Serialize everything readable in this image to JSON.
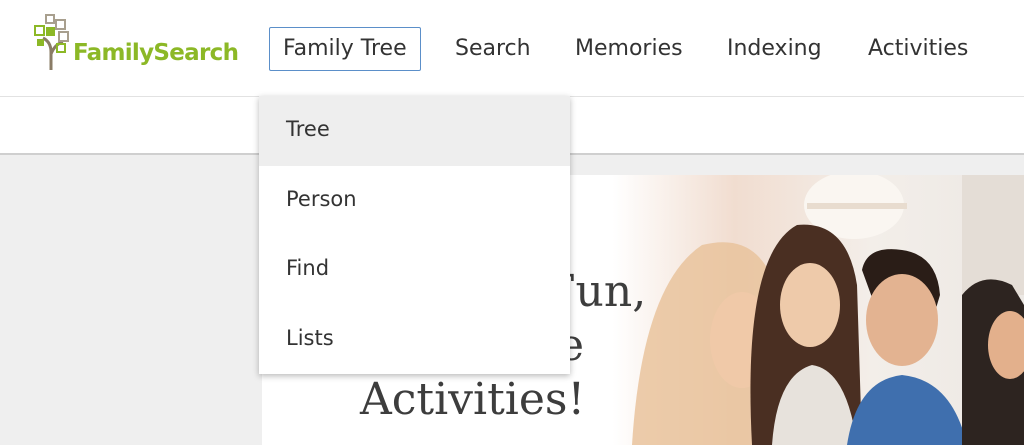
{
  "brand": {
    "name": "FamilySearch",
    "color": "#8cb826"
  },
  "nav": {
    "items": [
      {
        "label": "Family Tree",
        "active": true
      },
      {
        "label": "Search"
      },
      {
        "label": "Memories"
      },
      {
        "label": "Indexing"
      },
      {
        "label": "Activities"
      }
    ]
  },
  "dropdown": {
    "items": [
      {
        "label": "Tree",
        "highlighted": true
      },
      {
        "label": "Person"
      },
      {
        "label": "Find"
      },
      {
        "label": "Lists"
      }
    ]
  },
  "hero": {
    "title_line1": "r Fun,",
    "title_line2": "e",
    "title_line3": "Activities!"
  },
  "colors": {
    "nav_active_border": "#5b8fc9",
    "menu_highlight": "#eeeeee"
  }
}
